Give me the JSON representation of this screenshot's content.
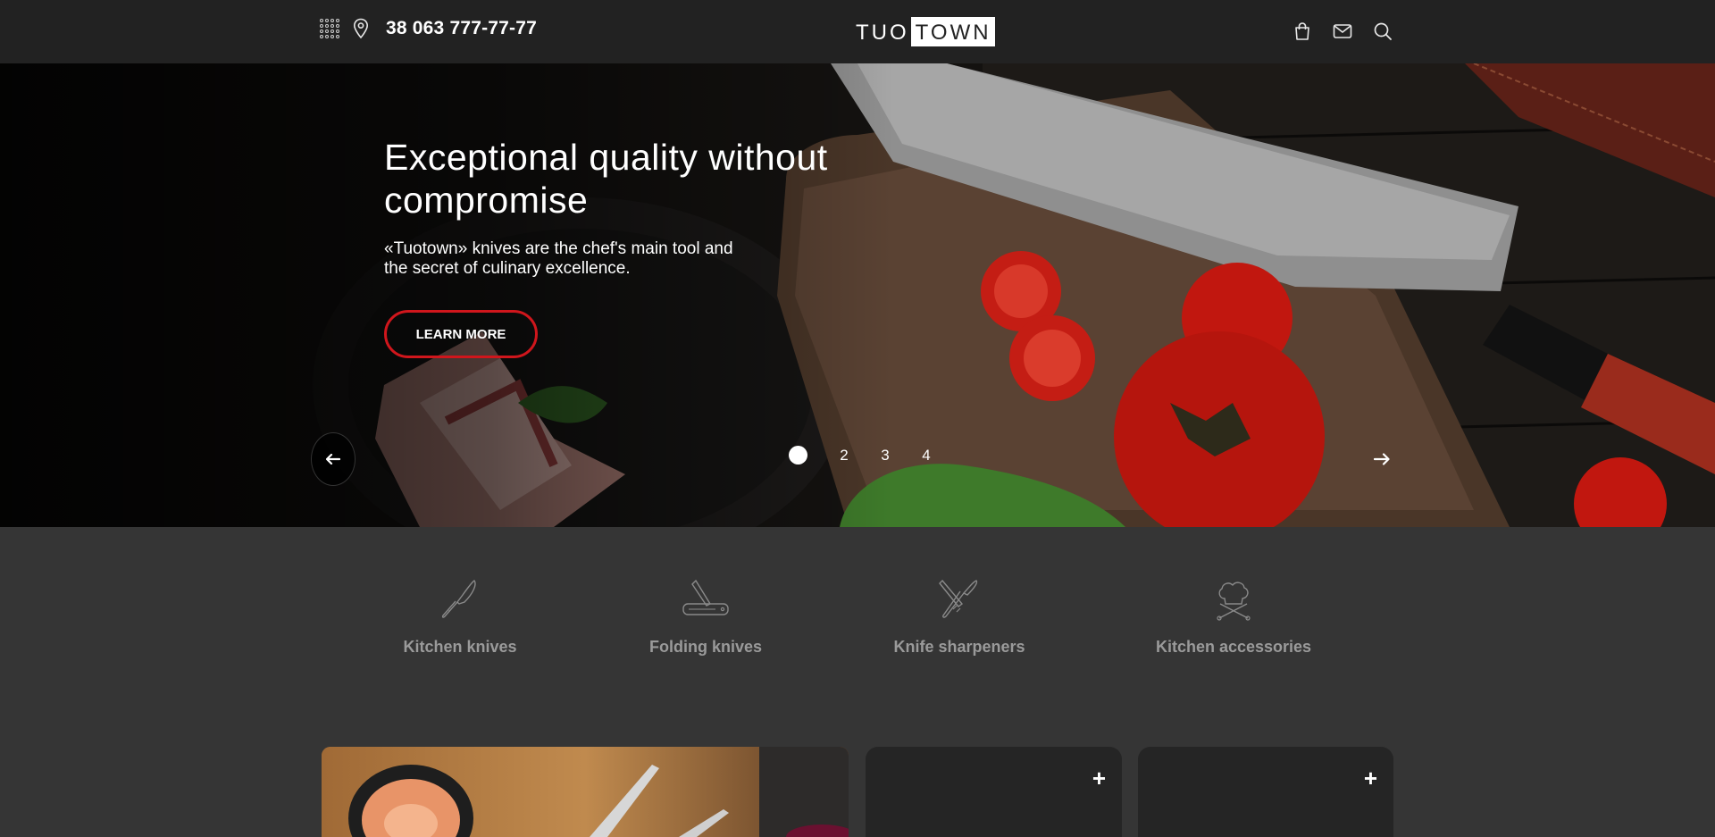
{
  "header": {
    "phone": "38 063 777-77-77",
    "logo_left": "TUO",
    "logo_right": "TOWN",
    "icons": [
      "grid-menu-icon",
      "location-pin-icon",
      "shopping-bag-icon",
      "mail-icon",
      "search-icon"
    ]
  },
  "hero": {
    "title": "Exceptional quality without compromise",
    "subtitle": "«Tuotown» knives are the chef's main tool and the secret of culinary excellence.",
    "button": "LEARN MORE",
    "slides": [
      "1",
      "2",
      "3",
      "4"
    ],
    "active_slide": 1
  },
  "categories": [
    {
      "label": "Kitchen knives",
      "icon": "kitchen-knife-icon"
    },
    {
      "label": "Folding knives",
      "icon": "folding-knife-icon"
    },
    {
      "label": "Knife sharpeners",
      "icon": "sharpener-icon"
    },
    {
      "label": "Kitchen accessories",
      "icon": "chef-hat-icon"
    }
  ],
  "cards": [
    {
      "type": "photo"
    },
    {
      "type": "product",
      "plus": "+"
    },
    {
      "type": "product",
      "plus": "+"
    }
  ],
  "colors": {
    "accent_red": "#d0161c",
    "header_bg": "#222222",
    "page_bg": "#353535",
    "category_text": "#9a9a9a"
  }
}
